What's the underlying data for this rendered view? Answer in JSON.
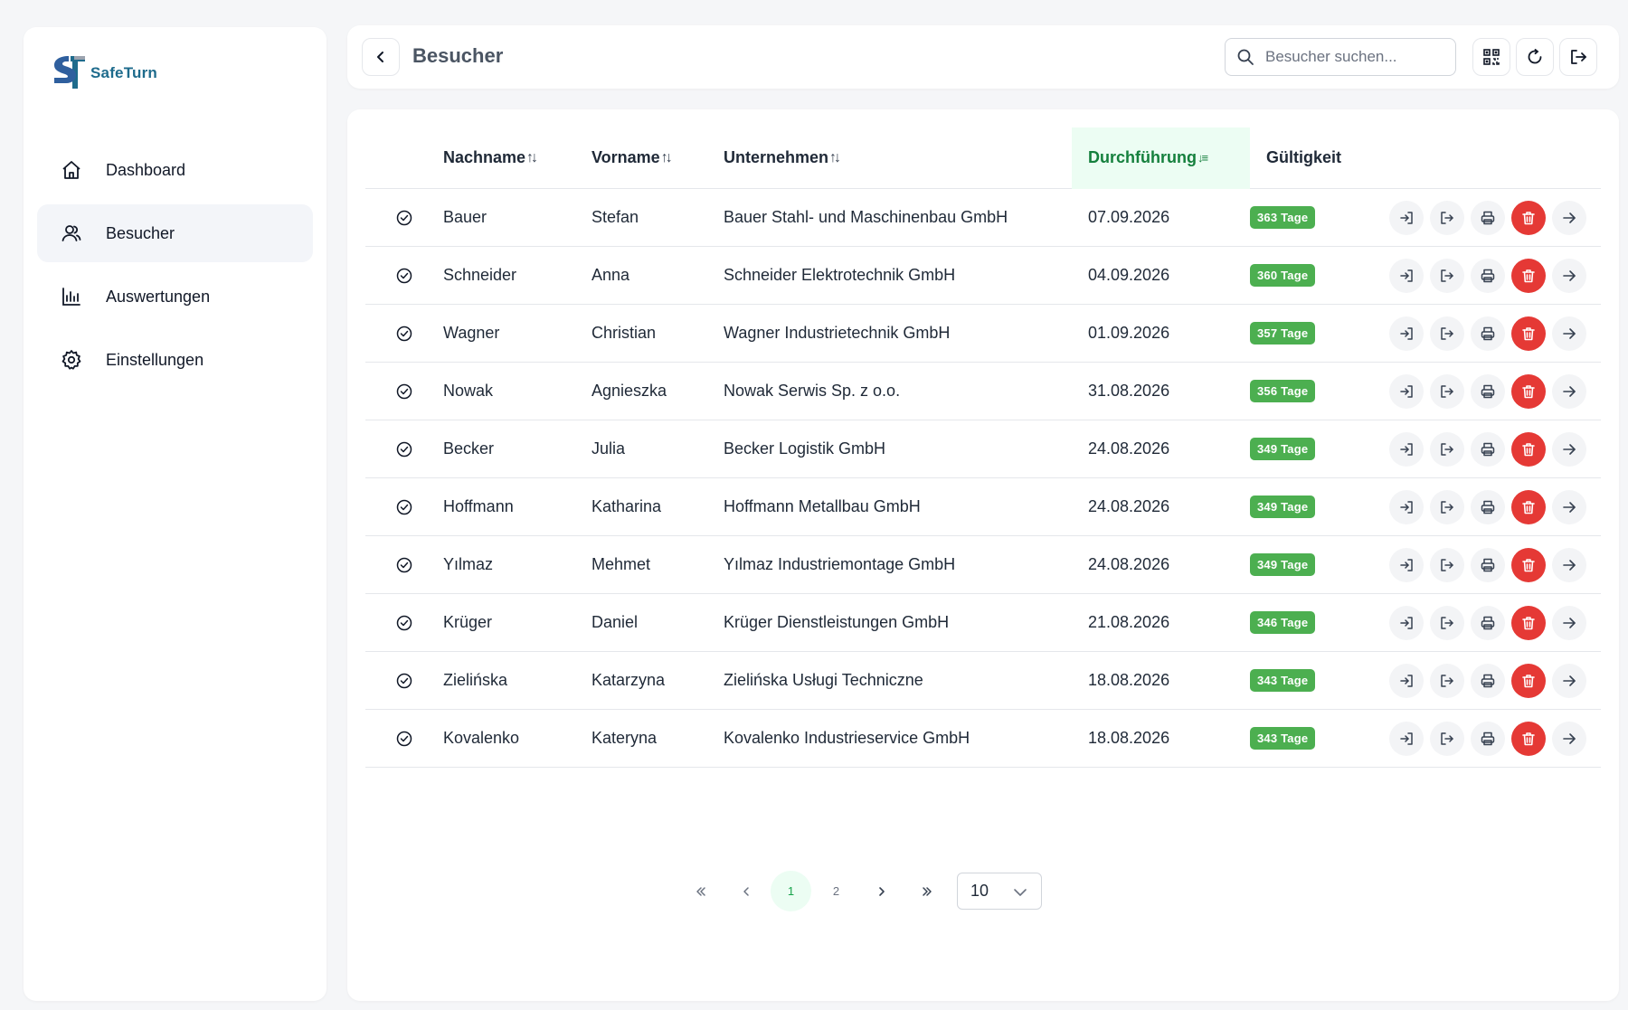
{
  "app": {
    "logo_text": "SafeTurn",
    "accent": "#16a34a",
    "brand": "#1e6b8c",
    "danger": "#e53935",
    "badge_green": "#4caf50"
  },
  "sidebar": {
    "items": [
      {
        "label": "Dashboard",
        "icon": "home-icon",
        "active": false
      },
      {
        "label": "Besucher",
        "icon": "users-icon",
        "active": true
      },
      {
        "label": "Auswertungen",
        "icon": "bar-chart-icon",
        "active": false
      },
      {
        "label": "Einstellungen",
        "icon": "gear-icon",
        "active": false
      }
    ]
  },
  "header": {
    "title": "Besucher",
    "search_placeholder": "Besucher suchen..."
  },
  "table": {
    "columns": {
      "last_name": "Nachname",
      "first_name": "Vorname",
      "company": "Unternehmen",
      "date": "Durchführung",
      "validity": "Gültigkeit"
    },
    "sort_both": "↑↓",
    "sort_desc": "↓≡",
    "rows": [
      {
        "last": "Bauer",
        "first": "Stefan",
        "company": "Bauer Stahl- und Maschinenbau GmbH",
        "date": "07.09.2026",
        "validity": "363 Tage"
      },
      {
        "last": "Schneider",
        "first": "Anna",
        "company": "Schneider Elektrotechnik GmbH",
        "date": "04.09.2026",
        "validity": "360 Tage"
      },
      {
        "last": "Wagner",
        "first": "Christian",
        "company": "Wagner Industrietechnik GmbH",
        "date": "01.09.2026",
        "validity": "357 Tage"
      },
      {
        "last": "Nowak",
        "first": "Agnieszka",
        "company": "Nowak Serwis Sp. z o.o.",
        "date": "31.08.2026",
        "validity": "356 Tage"
      },
      {
        "last": "Becker",
        "first": "Julia",
        "company": "Becker Logistik GmbH",
        "date": "24.08.2026",
        "validity": "349 Tage"
      },
      {
        "last": "Hoffmann",
        "first": "Katharina",
        "company": "Hoffmann Metallbau GmbH",
        "date": "24.08.2026",
        "validity": "349 Tage"
      },
      {
        "last": "Yılmaz",
        "first": "Mehmet",
        "company": "Yılmaz Industriemontage GmbH",
        "date": "24.08.2026",
        "validity": "349 Tage"
      },
      {
        "last": "Krüger",
        "first": "Daniel",
        "company": "Krüger Dienstleistungen GmbH",
        "date": "21.08.2026",
        "validity": "346 Tage"
      },
      {
        "last": "Zielińska",
        "first": "Katarzyna",
        "company": "Zielińska Usługi Techniczne",
        "date": "18.08.2026",
        "validity": "343 Tage"
      },
      {
        "last": "Kovalenko",
        "first": "Kateryna",
        "company": "Kovalenko Industrieservice GmbH",
        "date": "18.08.2026",
        "validity": "343 Tage"
      }
    ]
  },
  "pagination": {
    "pages": [
      "1",
      "2"
    ],
    "current": "1",
    "page_size": "10"
  }
}
